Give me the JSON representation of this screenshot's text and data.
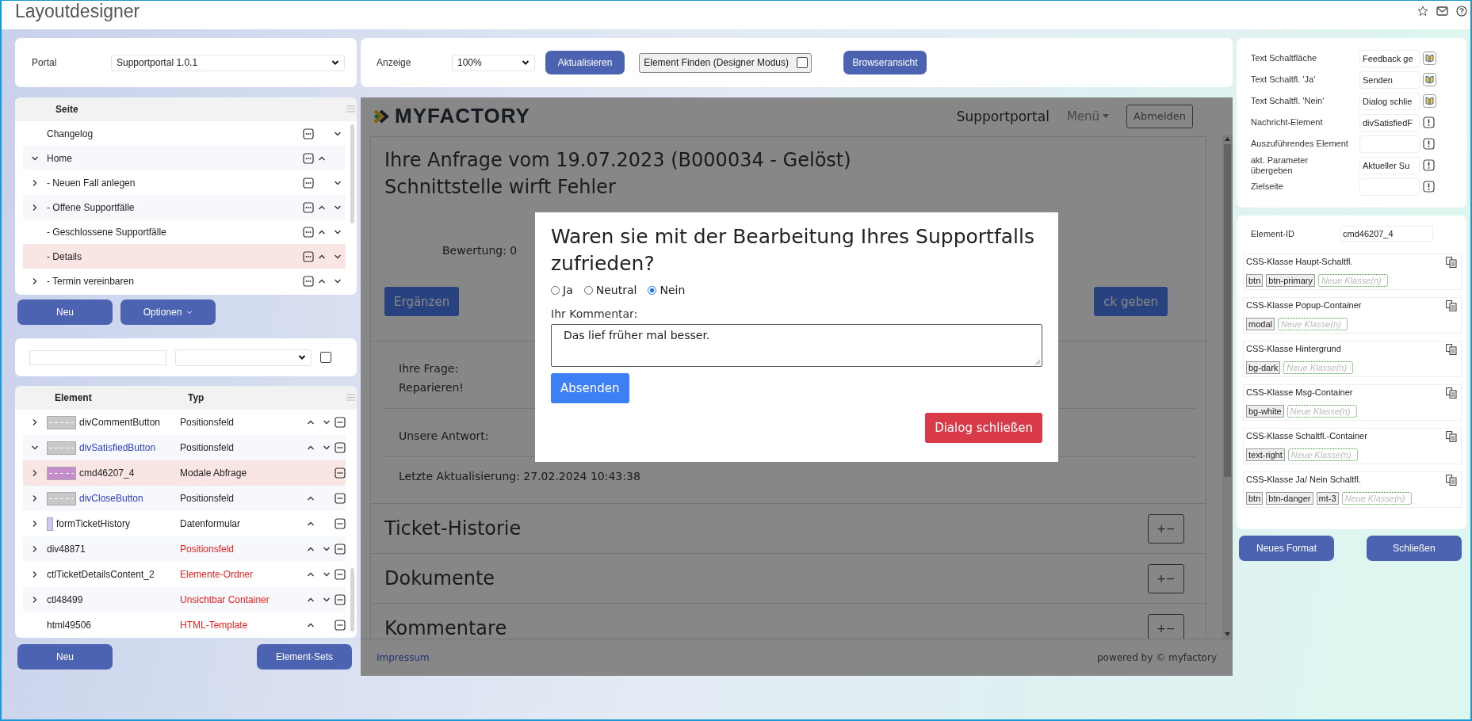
{
  "window": {
    "title": "Layoutdesigner"
  },
  "portal": {
    "label": "Portal",
    "value": "Supportportal 1.0.1"
  },
  "pages": {
    "column": "Seite",
    "items": [
      {
        "name": "Changelog",
        "move_up": false,
        "move_down": true,
        "selected": false
      },
      {
        "name": "Home",
        "expanded": true,
        "move_up": true,
        "move_down": false,
        "selected": false,
        "children": [
          {
            "name": "- Neuen Fall anlegen",
            "expanded": false,
            "move_up": false,
            "move_down": true,
            "selected": false
          },
          {
            "name": "- Offene Supportfälle",
            "expanded": false,
            "move_up": true,
            "move_down": true,
            "selected": false
          },
          {
            "name": "- Geschlossene Supportfälle",
            "move_up": true,
            "move_down": true,
            "selected": false
          },
          {
            "name": "- Details",
            "move_up": true,
            "move_down": true,
            "selected": true
          },
          {
            "name": "- Termin vereinbaren",
            "expanded": false,
            "move_up": true,
            "move_down": true,
            "selected": false
          }
        ]
      }
    ]
  },
  "page_buttons": [
    {
      "label": "Neu",
      "menu": false
    },
    {
      "label": "Optionen",
      "menu": true
    }
  ],
  "filter": {
    "checked": false
  },
  "elements": {
    "columns": [
      "Element",
      "Typ"
    ],
    "rows": [
      {
        "name": "divCommentButton",
        "type": "Positionsfeld",
        "expanded": false,
        "kind": "bar",
        "color": "#c8c8c8",
        "highlighted": false,
        "warning": false,
        "move_up": true,
        "move_down": true,
        "selected": false
      },
      {
        "name": "divSatisfiedButton",
        "type": "Positionsfeld",
        "expanded": true,
        "kind": "bar",
        "color": "#c8c8c8",
        "highlighted": true,
        "warning": false,
        "move_up": true,
        "move_down": true,
        "selected": false
      },
      {
        "name": "cmd46207_4",
        "type": "Modale Abfrage",
        "expanded": false,
        "kind": "bar",
        "color": "#c48ccb",
        "highlighted": false,
        "warning": false,
        "move_up": false,
        "move_down": false,
        "selected": true
      },
      {
        "name": "divCloseButton",
        "type": "Positionsfeld",
        "expanded": false,
        "kind": "bar",
        "color": "#c8c8c8",
        "highlighted": true,
        "warning": false,
        "move_up": true,
        "move_down": false,
        "selected": false
      },
      {
        "name": "formTicketHistory",
        "type": "Datenformular",
        "expanded": false,
        "kind": "thin",
        "color": "#c9c9f3",
        "highlighted": false,
        "warning": false,
        "move_up": true,
        "move_down": false,
        "selected": false
      },
      {
        "name": "div48871",
        "type": "Positionsfeld",
        "expanded": false,
        "highlighted": false,
        "warning": true,
        "move_up": true,
        "move_down": true,
        "selected": false
      },
      {
        "name": "ctlTicketDetailsContent_2",
        "type": "Elemente-Ordner",
        "expanded": false,
        "highlighted": false,
        "warning": true,
        "move_up": true,
        "move_down": true,
        "selected": false
      },
      {
        "name": "ctl48499",
        "type": "Unsichtbar Container",
        "expanded": false,
        "highlighted": false,
        "warning": true,
        "move_up": true,
        "move_down": true,
        "selected": false
      },
      {
        "name": "html49506",
        "type": "HTML-Template",
        "highlighted": false,
        "warning": true,
        "move_up": true,
        "move_down": false,
        "selected": false
      }
    ]
  },
  "element_buttons": [
    "Neu",
    "Element-Sets"
  ],
  "toolbar": {
    "display_label": "Anzeige",
    "zoom": "100%",
    "refresh": "Aktualisieren",
    "find": {
      "label": "Element Finden (Designer Modus)",
      "checked": false
    },
    "browser_view": "Browseransicht"
  },
  "preview": {
    "logo": "MYFACTORY",
    "nav": {
      "title": "Supportportal",
      "menu": "Menü",
      "logout": "Abmelden"
    },
    "heading": [
      "Ihre Anfrage vom 19.07.2023 (B000034 - Gelöst)",
      "Schnittstelle wirft Fehler"
    ],
    "rating": "Bewertung: 0",
    "add_button": "Ergänzen",
    "feedback_button": "ck geben",
    "question_label": "Ihre Frage:",
    "question": "Reparieren!",
    "answer_label": "Unsere Antwort:",
    "updated": "Letzte Aktualisierung: 27.02.2024 10:43:38",
    "sections": [
      {
        "title": "Ticket-Historie",
        "toggle": "+−"
      },
      {
        "title": "Dokumente",
        "toggle": "+−"
      },
      {
        "title": "Kommentare",
        "toggle": "+−"
      }
    ],
    "footer": {
      "link": "Impressum",
      "credit": "powered by © myfactory"
    }
  },
  "dialog": {
    "title": "Waren sie mit der Bearbeitung Ihres Supportfalls zufrieden?",
    "options": [
      {
        "label": "Ja",
        "selected": false
      },
      {
        "label": "Neutral",
        "selected": false
      },
      {
        "label": "Nein",
        "selected": true
      }
    ],
    "comment_label": "Ihr Kommentar:",
    "comment": "Das lief früher mal besser.",
    "submit": "Absenden",
    "close": "Dialog schließen"
  },
  "properties": [
    {
      "label": "Text Schaltfläche",
      "value": "Feedback ge",
      "kind": "translate"
    },
    {
      "label": "Text Schaltfl. 'Ja'",
      "value": "Senden",
      "kind": "translate"
    },
    {
      "label": "Text Schaltfl. 'Nein'",
      "value": "Dialog schlie",
      "kind": "translate"
    },
    {
      "label": "Nachricht-Element",
      "value": "divSatisfiedF",
      "kind": "alert"
    },
    {
      "label": "Auszuführendes Element",
      "kind": "alert"
    },
    {
      "label": "akt. Parameter übergeben",
      "value": "Aktueller Su",
      "kind": "alert"
    },
    {
      "label": "Zielseite",
      "kind": "alert"
    }
  ],
  "element_id": {
    "label": "Element-ID",
    "value": "cmd46207_4"
  },
  "css_groups": [
    {
      "label": "CSS-Klasse Haupt-Schaltfl.",
      "classes": [
        "btn",
        "btn-primary"
      ],
      "placeholder": "Neue Klasse(n)"
    },
    {
      "label": "CSS-Klasse Popup-Container",
      "classes": [
        "modal"
      ],
      "placeholder": "Neue Klasse(n)"
    },
    {
      "label": "CSS-Klasse Hintergrund",
      "classes": [
        "bg-dark"
      ],
      "placeholder": "Neue Klasse(n)"
    },
    {
      "label": "CSS-Klasse Msg-Container",
      "classes": [
        "bg-white"
      ],
      "placeholder": "Neue Klasse(n)"
    },
    {
      "label": "CSS-Klasse Schaltfl.-Container",
      "classes": [
        "text-right"
      ],
      "placeholder": "Neue Klasse(n)"
    },
    {
      "label": "CSS-Klasse Ja/ Nein Schaltfl.",
      "classes": [
        "btn",
        "btn-danger",
        "mt-3"
      ],
      "placeholder": "Neue Klasse(n)"
    }
  ],
  "footer_buttons": [
    "Neues Format",
    "Schließen"
  ]
}
